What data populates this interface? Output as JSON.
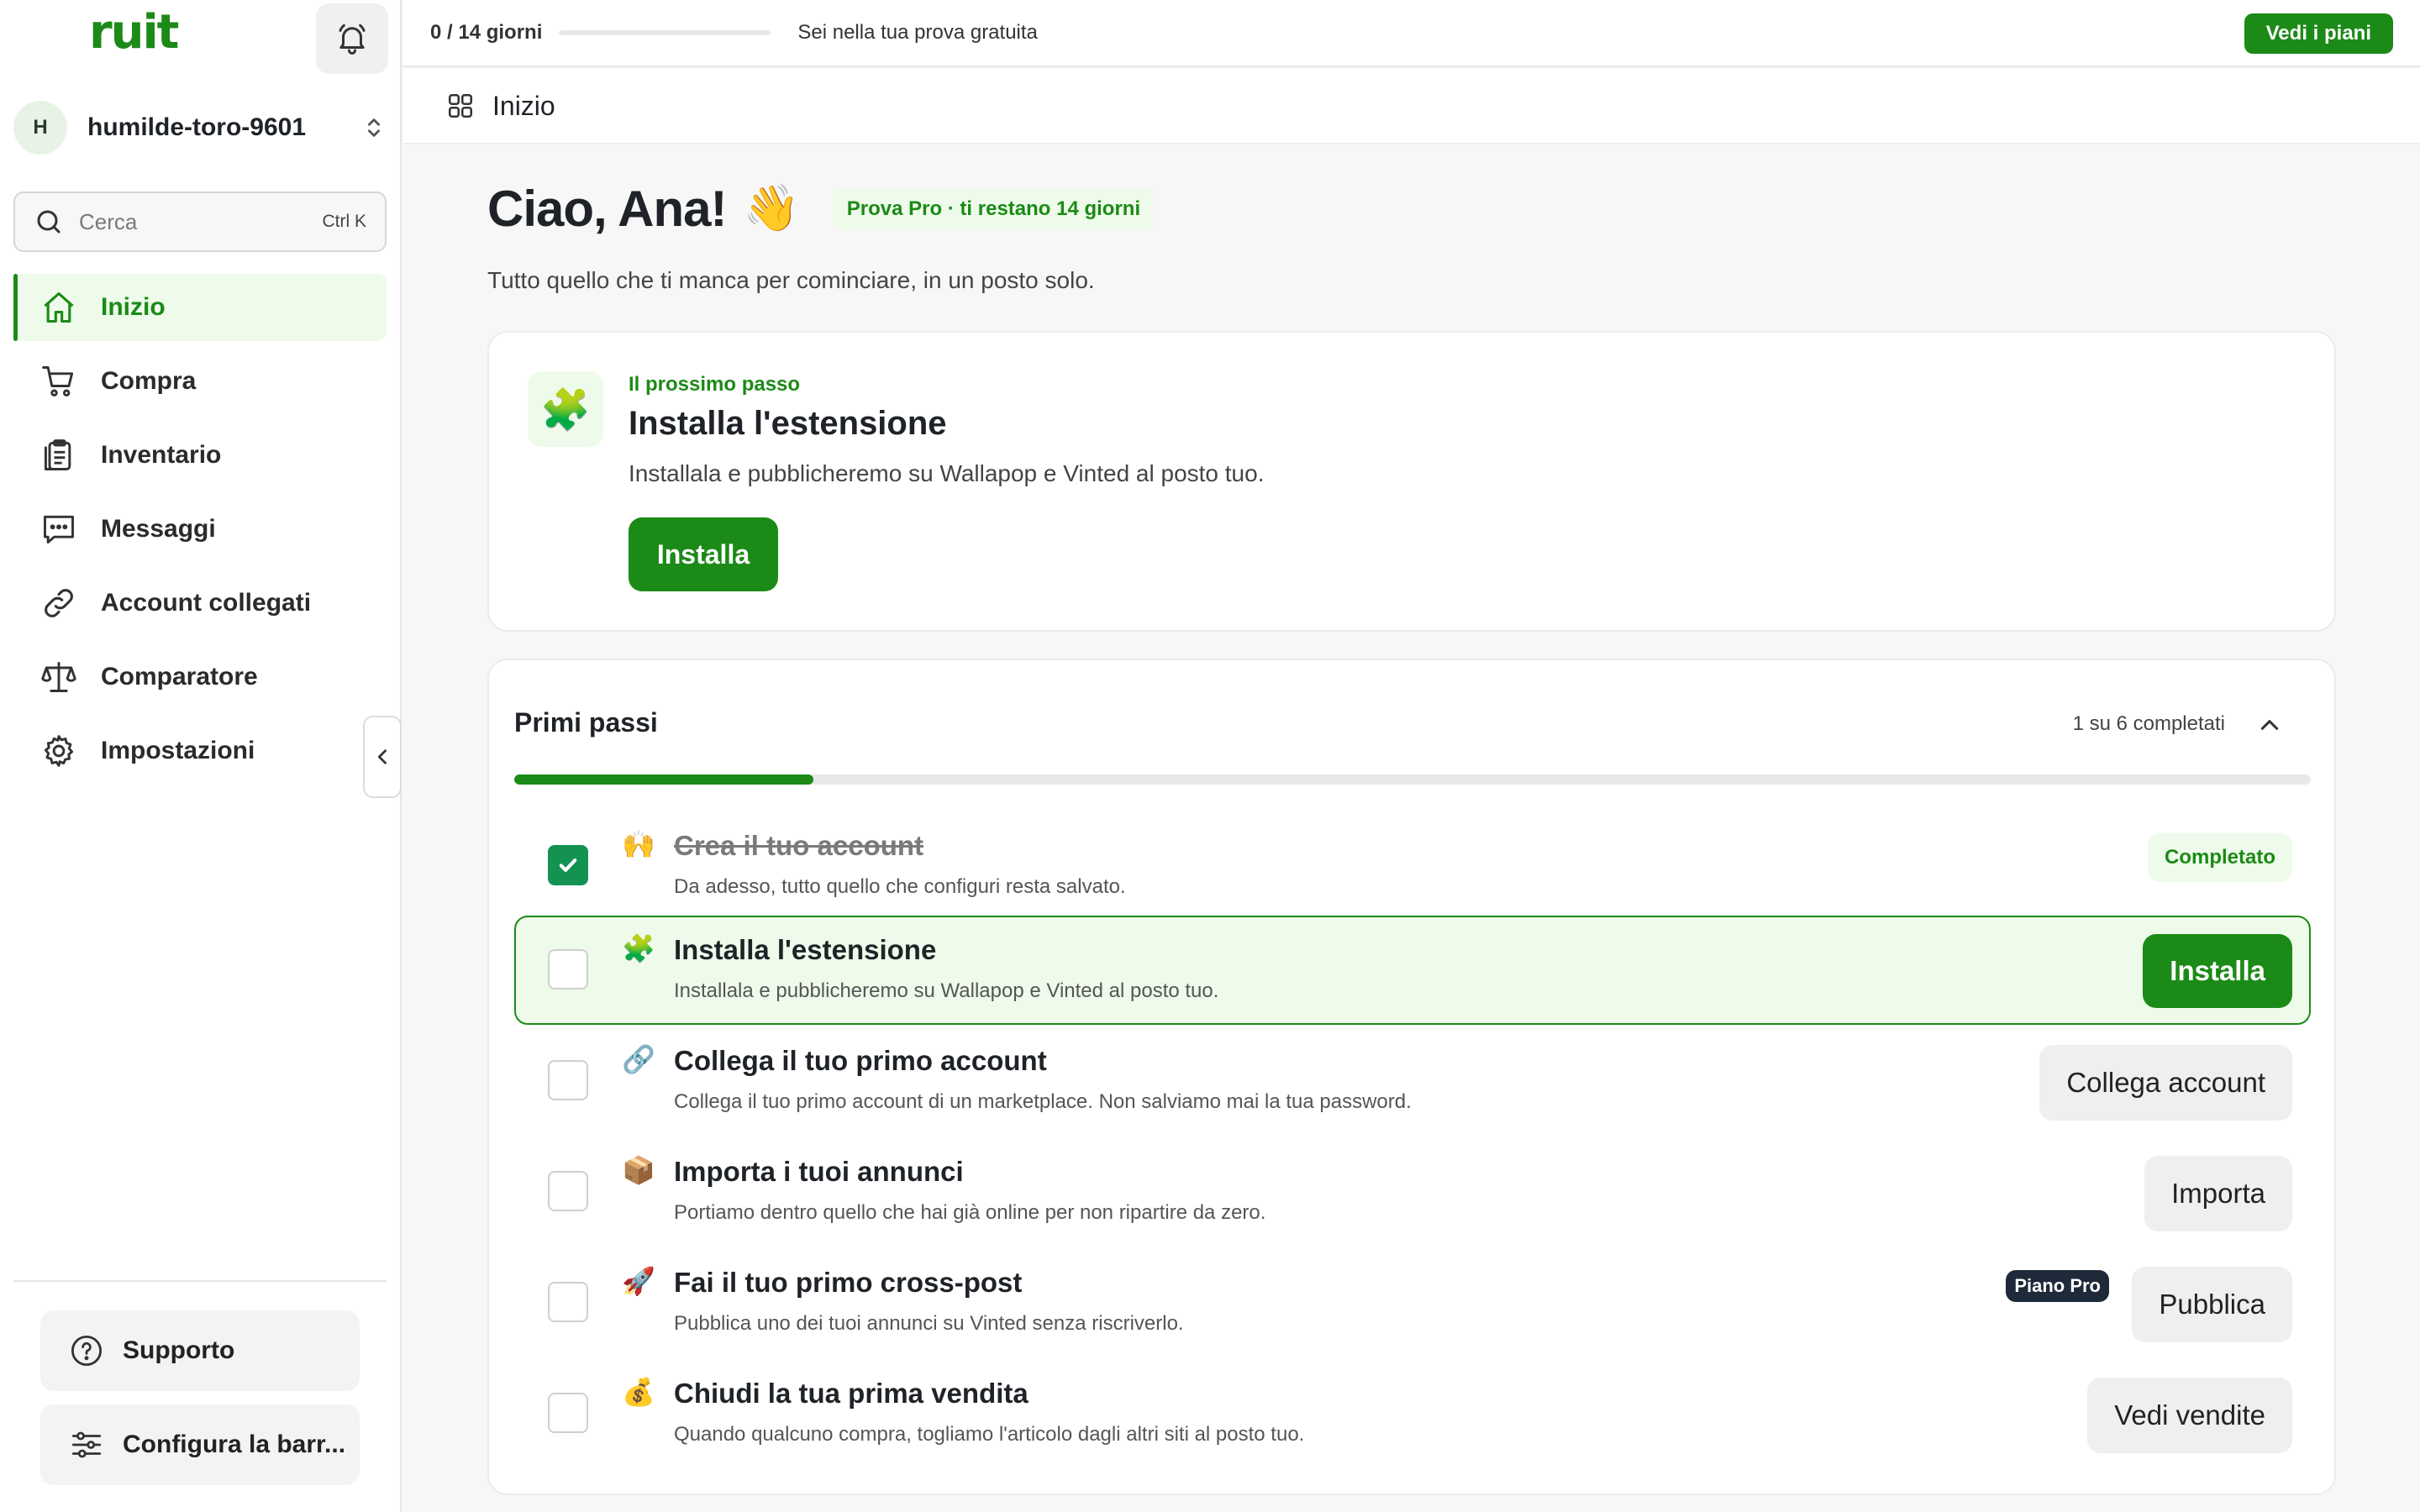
{
  "sidebar": {
    "logo": "ruit",
    "workspace": {
      "initial": "H",
      "name": "humilde-toro-9601"
    },
    "search": {
      "placeholder": "Cerca",
      "shortcut": "Ctrl K"
    },
    "nav": [
      {
        "label": "Inizio",
        "icon": "home-icon",
        "active": true
      },
      {
        "label": "Compra",
        "icon": "cart-icon"
      },
      {
        "label": "Inventario",
        "icon": "clipboard-icon"
      },
      {
        "label": "Messaggi",
        "icon": "chat-icon"
      },
      {
        "label": "Account collegati",
        "icon": "link-icon"
      },
      {
        "label": "Comparatore",
        "icon": "scale-icon"
      },
      {
        "label": "Impostazioni",
        "icon": "gear-icon"
      }
    ],
    "footer": {
      "support": "Supporto",
      "configure": "Configura la barr..."
    }
  },
  "topbar": {
    "trial_count": "0 / 14 giorni",
    "trial_progress": 0,
    "trial_text": "Sei nella tua prova gratuita",
    "plans_button": "Vedi i piani"
  },
  "breadcrumb": {
    "title": "Inizio"
  },
  "main": {
    "greeting": "Ciao, Ana!",
    "greeting_emoji": "👋",
    "pro_badge": "Prova Pro · ti restano 14 giorni",
    "subtitle": "Tutto quello che ti manca per cominciare, in un posto solo.",
    "next_step": {
      "emoji": "🧩",
      "kicker": "Il prossimo passo",
      "title": "Installa l'estensione",
      "description": "Installala e pubblicheremo su Wallapop e Vinted al posto tuo.",
      "button": "Installa"
    },
    "steps": {
      "title": "Primi passi",
      "count": "1 su 6 completati",
      "progress": 0.1667,
      "items": [
        {
          "emoji": "🙌",
          "title": "Crea il tuo account",
          "description": "Da adesso, tutto quello che configuri resta salvato.",
          "done": true,
          "badge": "Completato"
        },
        {
          "emoji": "🧩",
          "title": "Installa l'estensione",
          "description": "Installala e pubblicheremo su Wallapop e Vinted al posto tuo.",
          "action": "Installa",
          "highlight": true
        },
        {
          "emoji": "🔗",
          "title": "Collega il tuo primo account",
          "description": "Collega il tuo primo account di un marketplace. Non salviamo mai la tua password.",
          "action": "Collega account"
        },
        {
          "emoji": "📦",
          "title": "Importa i tuoi annunci",
          "description": "Portiamo dentro quello che hai già online per non ripartire da zero.",
          "action": "Importa"
        },
        {
          "emoji": "🚀",
          "title": "Fai il tuo primo cross-post",
          "description": "Pubblica uno dei tuoi annunci su Vinted senza riscriverlo.",
          "action": "Pubblica",
          "plan_badge": "Piano Pro"
        },
        {
          "emoji": "💰",
          "title": "Chiudi la tua prima vendita",
          "description": "Quando qualcuno compra, togliamo l'articolo dagli altri siti al posto tuo.",
          "action": "Vedi vendite"
        }
      ]
    }
  },
  "colors": {
    "brand": "#1c8a17",
    "brand_light": "#eefbea",
    "check": "#139252"
  }
}
